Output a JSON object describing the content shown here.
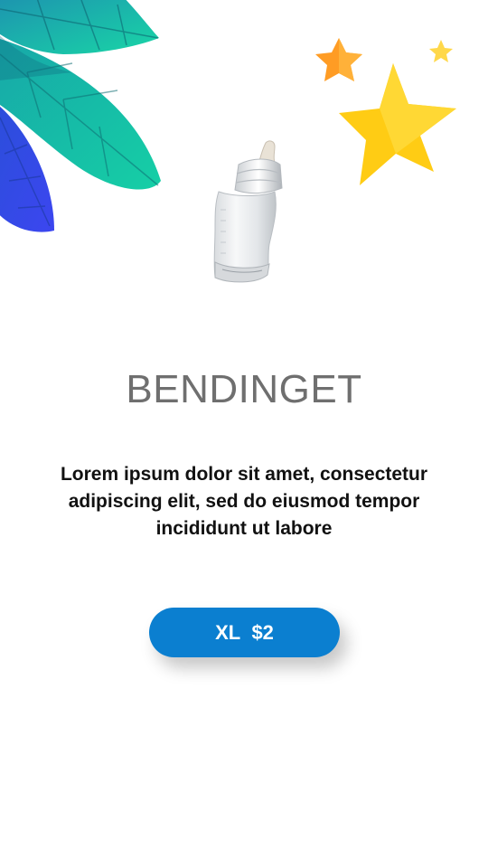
{
  "product": {
    "name": "BENDINGET",
    "description": "Lorem ipsum dolor sit amet, consectetur adipiscing elit, sed do eiusmod tempor incididunt ut labore",
    "size": "XL",
    "price": "$2"
  },
  "icons": {
    "decoration_left": "leaves-decoration",
    "decoration_right": "stars-decoration",
    "product_image": "baby-bottle-image"
  },
  "colors": {
    "button": "#0b7fd0",
    "title": "#6f6f6f",
    "star_yellow": "#ffd21a",
    "star_orange": "#ff9f1c",
    "leaf_teal": "#18b4b4",
    "leaf_blue": "#3b4fe6"
  }
}
